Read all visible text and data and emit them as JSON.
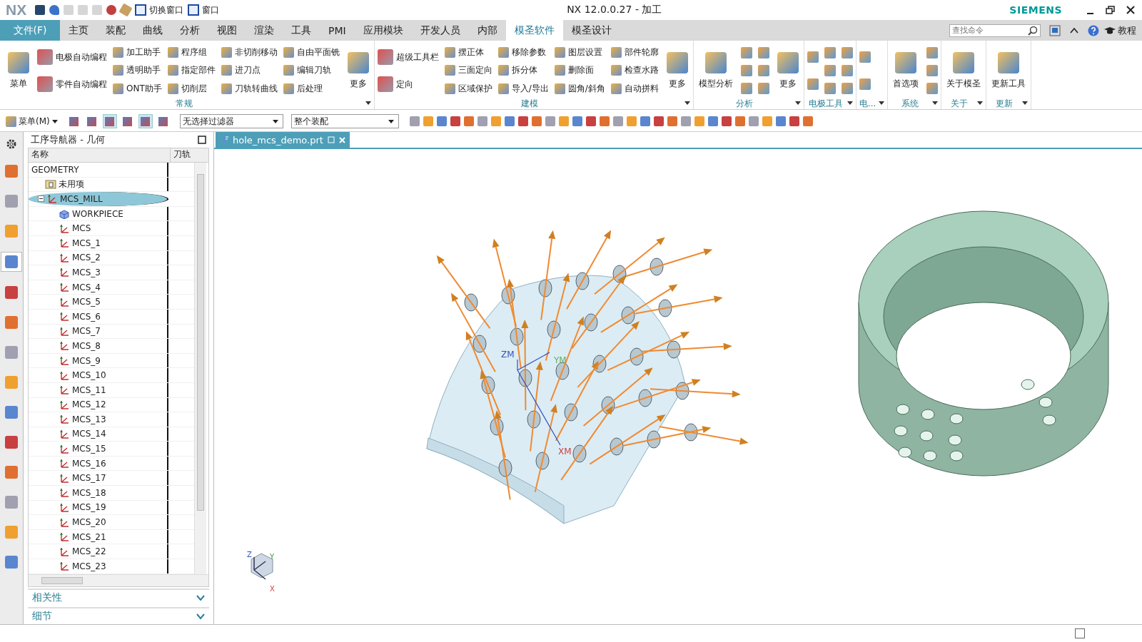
{
  "window": {
    "logo": "NX",
    "title": "NX 12.0.0.27 - 加工",
    "brand": "SIEMENS"
  },
  "quick_access": [
    {
      "label": "切换窗口"
    },
    {
      "label": "窗口"
    }
  ],
  "file_menu": "文件(F)",
  "tabs": [
    {
      "label": "主页",
      "selected": false
    },
    {
      "label": "装配",
      "selected": false
    },
    {
      "label": "曲线",
      "selected": false
    },
    {
      "label": "分析",
      "selected": false
    },
    {
      "label": "视图",
      "selected": false
    },
    {
      "label": "渲染",
      "selected": false
    },
    {
      "label": "工具",
      "selected": false
    },
    {
      "label": "PMI",
      "selected": false
    },
    {
      "label": "应用模块",
      "selected": false
    },
    {
      "label": "开发人员",
      "selected": false
    },
    {
      "label": "内部",
      "selected": false
    },
    {
      "label": "模圣软件",
      "selected": true
    },
    {
      "label": "模圣设计",
      "selected": false
    }
  ],
  "search": {
    "placeholder": "查找命令"
  },
  "help_label": "教程",
  "ribbon_groups": [
    {
      "title": "常规",
      "columns": [
        [
          {
            "kind": "large",
            "label": "菜单"
          }
        ],
        [
          {
            "kind": "medium",
            "label": "电极自动编程"
          },
          {
            "kind": "medium",
            "label": "零件自动编程"
          }
        ],
        [
          {
            "kind": "small",
            "label": "加工助手"
          },
          {
            "kind": "small",
            "label": "透明助手"
          },
          {
            "kind": "small",
            "label": "ONT助手"
          }
        ],
        [
          {
            "kind": "small",
            "label": "程序组"
          },
          {
            "kind": "small",
            "label": "指定部件"
          },
          {
            "kind": "small",
            "label": "切削层"
          }
        ],
        [
          {
            "kind": "small",
            "label": "非切削移动"
          },
          {
            "kind": "small",
            "label": "进刀点"
          },
          {
            "kind": "small",
            "label": "刀轨转曲线"
          }
        ],
        [
          {
            "kind": "small",
            "label": "自由平面铣"
          },
          {
            "kind": "small",
            "label": "编辑刀轨"
          },
          {
            "kind": "small",
            "label": "后处理"
          }
        ],
        [
          {
            "kind": "large",
            "label": "更多"
          }
        ]
      ]
    },
    {
      "title": "建模",
      "columns": [
        [
          {
            "kind": "medium",
            "label": "超级工具栏"
          },
          {
            "kind": "medium",
            "label": "定向"
          }
        ],
        [
          {
            "kind": "small",
            "label": "摆正体"
          },
          {
            "kind": "small",
            "label": "三面定向"
          },
          {
            "kind": "small",
            "label": "区域保护"
          }
        ],
        [
          {
            "kind": "small",
            "label": "移除参数"
          },
          {
            "kind": "small",
            "label": "拆分体"
          },
          {
            "kind": "small",
            "label": "导入/导出"
          }
        ],
        [
          {
            "kind": "small",
            "label": "图层设置"
          },
          {
            "kind": "small",
            "label": "删除面"
          },
          {
            "kind": "small",
            "label": "圆角/斜角"
          }
        ],
        [
          {
            "kind": "small",
            "label": "部件轮廓"
          },
          {
            "kind": "small",
            "label": "检查水路"
          },
          {
            "kind": "small",
            "label": "自动拼料"
          }
        ],
        [
          {
            "kind": "large",
            "label": "更多"
          }
        ]
      ]
    },
    {
      "title": "分析",
      "columns": [
        [
          {
            "kind": "large",
            "label": "模型分析"
          }
        ],
        [
          {
            "kind": "icon"
          },
          {
            "kind": "icon"
          },
          {
            "kind": "icon"
          }
        ],
        [
          {
            "kind": "icon"
          },
          {
            "kind": "icon"
          },
          {
            "kind": "icon"
          }
        ],
        [
          {
            "kind": "large",
            "label": "更多"
          }
        ]
      ]
    },
    {
      "title": "电极工具",
      "columns": [
        [
          {
            "kind": "icon"
          },
          {
            "kind": "icon"
          }
        ],
        [
          {
            "kind": "icon"
          },
          {
            "kind": "icon"
          },
          {
            "kind": "icon"
          }
        ],
        [
          {
            "kind": "icon"
          },
          {
            "kind": "icon"
          },
          {
            "kind": "icon"
          }
        ]
      ]
    },
    {
      "title": "电...",
      "columns": [
        [
          {
            "kind": "icon"
          },
          {
            "kind": "icon"
          }
        ]
      ]
    },
    {
      "title": "系统",
      "columns": [
        [
          {
            "kind": "large",
            "label": "首选项"
          }
        ],
        [
          {
            "kind": "icon"
          },
          {
            "kind": "icon"
          },
          {
            "kind": "icon"
          }
        ]
      ]
    },
    {
      "title": "关于",
      "columns": [
        [
          {
            "kind": "large",
            "label": "关于模圣"
          }
        ]
      ]
    },
    {
      "title": "更新",
      "columns": [
        [
          {
            "kind": "large",
            "label": "更新工具"
          }
        ]
      ]
    }
  ],
  "toolbar": {
    "menu_label": "菜单(M)",
    "toggles": [
      {
        "on": false
      },
      {
        "on": false
      },
      {
        "on": true
      },
      {
        "on": false
      },
      {
        "on": true
      },
      {
        "on": false
      }
    ],
    "filter": "无选择过滤器",
    "scope": "整个装配"
  },
  "resource_bar": [
    {
      "selected": false
    },
    {
      "selected": false
    },
    {
      "selected": false
    },
    {
      "selected": true
    },
    {
      "selected": false
    },
    {
      "selected": false
    },
    {
      "selected": false
    },
    {
      "selected": false
    },
    {
      "selected": false
    },
    {
      "selected": false
    },
    {
      "selected": false
    },
    {
      "selected": false
    },
    {
      "selected": false
    },
    {
      "selected": false
    }
  ],
  "navigator": {
    "title": "工序导航器 - 几何",
    "columns": [
      "名称",
      "刀轨"
    ],
    "tree": [
      {
        "label": "GEOMETRY",
        "selected": false,
        "children": [
          {
            "label": "未用项",
            "kind": "folder",
            "selected": false
          },
          {
            "label": "MCS_MILL",
            "kind": "mcs",
            "expanded": true,
            "selected": true,
            "children": [
              {
                "label": "WORKPIECE",
                "kind": "workpiece",
                "selected": false
              },
              {
                "label": "MCS",
                "kind": "mcs",
                "selected": false
              },
              {
                "label": "MCS_1",
                "kind": "mcs",
                "selected": false
              },
              {
                "label": "MCS_2",
                "kind": "mcs",
                "selected": false
              },
              {
                "label": "MCS_3",
                "kind": "mcs",
                "selected": false
              },
              {
                "label": "MCS_4",
                "kind": "mcs",
                "selected": false
              },
              {
                "label": "MCS_5",
                "kind": "mcs",
                "selected": false
              },
              {
                "label": "MCS_6",
                "kind": "mcs",
                "selected": false
              },
              {
                "label": "MCS_7",
                "kind": "mcs",
                "selected": false
              },
              {
                "label": "MCS_8",
                "kind": "mcs",
                "selected": false
              },
              {
                "label": "MCS_9",
                "kind": "mcs",
                "selected": false
              },
              {
                "label": "MCS_10",
                "kind": "mcs",
                "selected": false
              },
              {
                "label": "MCS_11",
                "kind": "mcs",
                "selected": false
              },
              {
                "label": "MCS_12",
                "kind": "mcs",
                "selected": false
              },
              {
                "label": "MCS_13",
                "kind": "mcs",
                "selected": false
              },
              {
                "label": "MCS_14",
                "kind": "mcs",
                "selected": false
              },
              {
                "label": "MCS_15",
                "kind": "mcs",
                "selected": false
              },
              {
                "label": "MCS_16",
                "kind": "mcs",
                "selected": false
              },
              {
                "label": "MCS_17",
                "kind": "mcs",
                "selected": false
              },
              {
                "label": "MCS_18",
                "kind": "mcs",
                "selected": false
              },
              {
                "label": "MCS_19",
                "kind": "mcs",
                "selected": false
              },
              {
                "label": "MCS_20",
                "kind": "mcs",
                "selected": false
              },
              {
                "label": "MCS_21",
                "kind": "mcs",
                "selected": false
              },
              {
                "label": "MCS_22",
                "kind": "mcs",
                "selected": false
              },
              {
                "label": "MCS_23",
                "kind": "mcs",
                "selected": false
              }
            ]
          }
        ]
      }
    ],
    "panels": [
      {
        "label": "相关性",
        "expanded": false
      },
      {
        "label": "细节",
        "expanded": false
      }
    ]
  },
  "viewport": {
    "tab": "hole_mcs_demo.prt",
    "model_axes": [
      "ZM",
      "YM",
      "XM"
    ],
    "view_triad": [
      "Z",
      "Y",
      "X"
    ]
  }
}
